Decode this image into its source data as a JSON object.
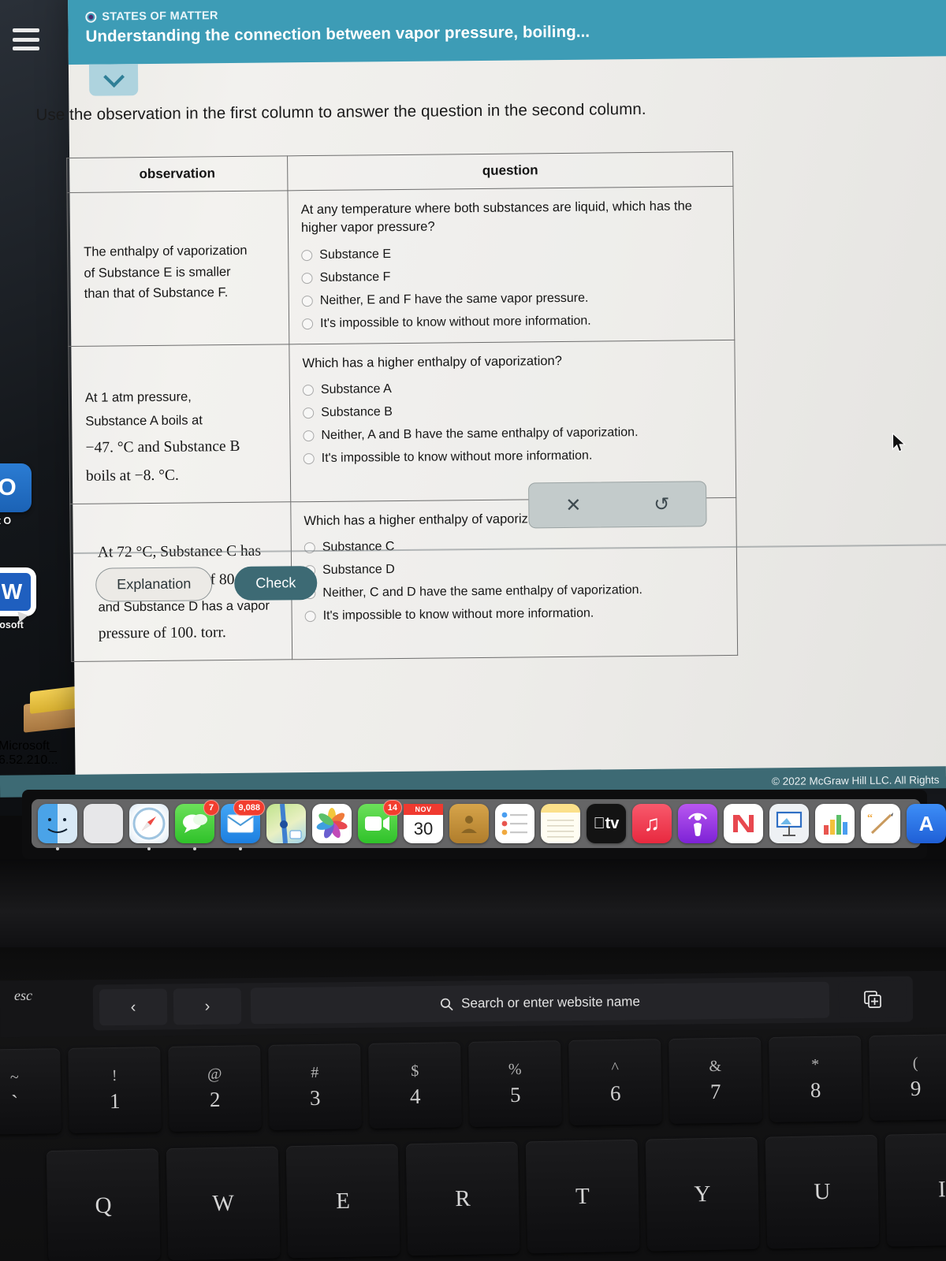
{
  "header": {
    "kicker": "STATES OF MATTER",
    "title": "Understanding the connection between vapor pressure, boiling...",
    "menu_icon": "hamburger-menu-icon",
    "collapse_icon": "chevron-down-icon"
  },
  "prompt": "Use the observation in the first column to answer the question in the second column.",
  "table": {
    "columns": [
      "observation",
      "question"
    ],
    "rows": [
      {
        "observation_parts": [
          {
            "text": "The enthalpy of vaporization",
            "style": "plain"
          },
          {
            "text": "of Substance E is smaller",
            "style": "plain"
          },
          {
            "text": "than that of Substance F.",
            "style": "plain"
          }
        ],
        "observation_plain": "The enthalpy of vaporization of Substance E is smaller than that of Substance F.",
        "question": "At any temperature where both substances are liquid, which has the higher vapor pressure?",
        "options": [
          "Substance E",
          "Substance F",
          "Neither, E and F have the same vapor pressure.",
          "It's impossible to know without more information."
        ],
        "selected": null
      },
      {
        "observation_plain": "At 1 atm pressure, Substance A boils at −47. °C and Substance B boils at −8. °C.",
        "observation_lines": [
          "At 1 atm pressure,",
          "Substance A boils at",
          "−47. °C and Substance B",
          "boils at −8. °C."
        ],
        "question": "Which has a higher enthalpy of vaporization?",
        "options": [
          "Substance A",
          "Substance B",
          "Neither, A and B have the same enthalpy of vaporization.",
          "It's impossible to know without more information."
        ],
        "selected": null
      },
      {
        "observation_plain": "At 72 °C, Substance C has a vapor pressure of 80. torr and Substance D has a vapor pressure of 100. torr.",
        "observation_lines": [
          "At 72 °C, Substance C has",
          "a vapor pressure of 80. torr",
          "and Substance D has a vapor",
          "pressure of 100. torr."
        ],
        "question": "Which has a higher enthalpy of vaporization?",
        "options": [
          "Substance C",
          "Substance D",
          "Neither, C and D have the same enthalpy of vaporization.",
          "It's impossible to know without more information."
        ],
        "selected": null
      }
    ]
  },
  "toolbox": {
    "clear_icon": "✕",
    "undo_icon": "↺",
    "clear_name": "clear-answers",
    "undo_name": "undo"
  },
  "footer": {
    "explanation_label": "Explanation",
    "check_label": "Check",
    "copyright": "© 2022 McGraw Hill LLC. All Rights"
  },
  "desktop": {
    "icons": [
      {
        "label": "soft O",
        "full_label": "Microsoft Outlook",
        "glyph": "O"
      },
      {
        "label": "icrosoft",
        "full_label": "Microsoft Word",
        "glyph": "W"
      },
      {
        "label_line1": "Microsoft_",
        "label_line2": "6.52.210...",
        "full_label": "Microsoft_ 6.52.210...",
        "glyph": "package"
      }
    ]
  },
  "dock": {
    "items": [
      {
        "name": "finder",
        "label": "Finder",
        "badge": null,
        "running": true
      },
      {
        "name": "launchpad",
        "label": "Launchpad",
        "badge": null,
        "running": false
      },
      {
        "name": "safari",
        "label": "Safari",
        "badge": null,
        "running": true
      },
      {
        "name": "messages",
        "label": "Messages",
        "badge": "7",
        "running": true
      },
      {
        "name": "mail",
        "label": "Mail",
        "badge": "9,088",
        "running": true
      },
      {
        "name": "maps",
        "label": "Maps",
        "badge": null,
        "running": false
      },
      {
        "name": "photos",
        "label": "Photos",
        "badge": null,
        "running": false
      },
      {
        "name": "facetime",
        "label": "FaceTime",
        "badge": "14",
        "running": false
      },
      {
        "name": "calendar",
        "label": "Calendar",
        "badge": null,
        "running": false,
        "month": "NOV",
        "day": "30"
      },
      {
        "name": "contacts",
        "label": "Contacts",
        "badge": null,
        "running": false
      },
      {
        "name": "reminders",
        "label": "Reminders",
        "badge": null,
        "running": false
      },
      {
        "name": "notes",
        "label": "Notes",
        "badge": null,
        "running": false
      },
      {
        "name": "appletv",
        "label": "Apple TV",
        "badge": null,
        "running": false,
        "text": "tv"
      },
      {
        "name": "music",
        "label": "Music",
        "badge": null,
        "running": false
      },
      {
        "name": "podcasts",
        "label": "Podcasts",
        "badge": null,
        "running": false
      },
      {
        "name": "news",
        "label": "News",
        "badge": null,
        "running": false
      },
      {
        "name": "keynote",
        "label": "Keynote",
        "badge": null,
        "running": false
      },
      {
        "name": "numbers",
        "label": "Numbers",
        "badge": null,
        "running": false
      },
      {
        "name": "pages",
        "label": "Pages",
        "badge": null,
        "running": false
      },
      {
        "name": "appstore",
        "label": "App Store",
        "badge": null,
        "running": false
      }
    ]
  },
  "touchbar": {
    "esc": "esc",
    "back_icon": "‹",
    "forward_icon": "›",
    "search_icon": "search-icon",
    "search_placeholder": "Search or enter website name",
    "tabs_icon": "new-tab-icon"
  },
  "keyboard": {
    "number_row": [
      {
        "sym": "~",
        "num": "`"
      },
      {
        "sym": "!",
        "num": "1"
      },
      {
        "sym": "@",
        "num": "2"
      },
      {
        "sym": "#",
        "num": "3"
      },
      {
        "sym": "$",
        "num": "4"
      },
      {
        "sym": "%",
        "num": "5"
      },
      {
        "sym": "^",
        "num": "6"
      },
      {
        "sym": "&",
        "num": "7"
      },
      {
        "sym": "*",
        "num": "8"
      },
      {
        "sym": "(",
        "num": "9"
      }
    ],
    "alpha_row": [
      "Q",
      "W",
      "E",
      "R",
      "T",
      "Y",
      "U",
      "I"
    ]
  },
  "colors": {
    "header_teal": "#3d9cb6",
    "footer_teal": "#3d6a74",
    "check_button": "#3d6a74",
    "collapse_tab": "#aed3de",
    "page_bg": "#edece9"
  }
}
